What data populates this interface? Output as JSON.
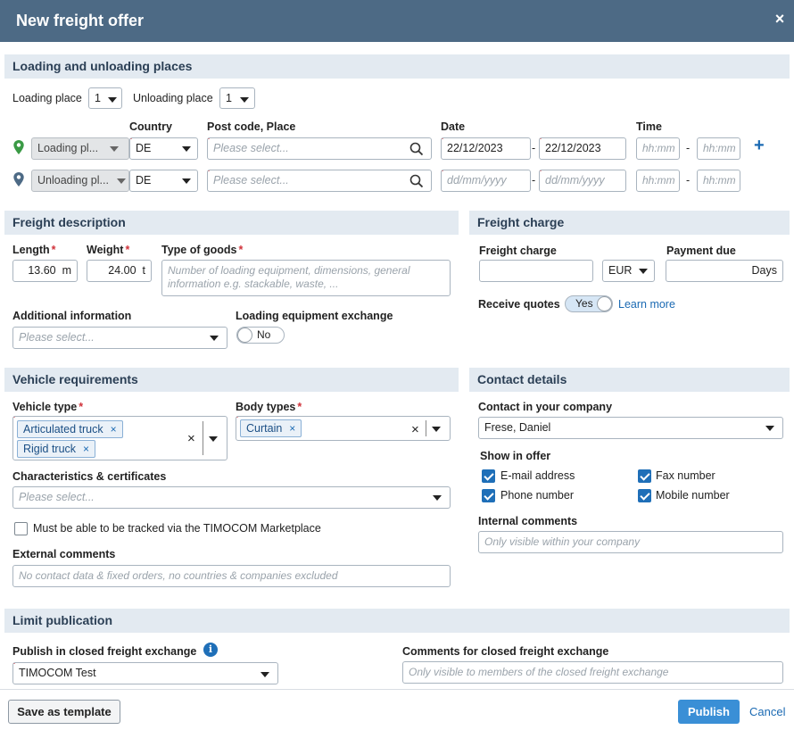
{
  "dialog": {
    "title": "New freight offer",
    "close_icon": "×"
  },
  "loading": {
    "section_title": "Loading and unloading places",
    "loading_place_label": "Loading place",
    "loading_place_value": "1",
    "unloading_place_label": "Unloading place",
    "unloading_place_value": "1",
    "col_country": "Country",
    "col_postcode": "Post code, Place",
    "col_date": "Date",
    "col_time": "Time",
    "rows": [
      {
        "type": "Loading pl...",
        "country": "DE",
        "place_placeholder": "Please select...",
        "date_from": "22/12/2023",
        "date_to": "22/12/2023",
        "time_from": "hh:mm",
        "time_to": "hh:mm",
        "pin_color": "#3a9a45"
      },
      {
        "type": "Unloading pl...",
        "country": "DE",
        "place_placeholder": "Please select...",
        "date_from": "dd/mm/yyyy",
        "date_to": "dd/mm/yyyy",
        "time_from": "hh:mm",
        "time_to": "hh:mm",
        "pin_color": "#4d6a85"
      }
    ],
    "dash": "-",
    "add_icon": "+"
  },
  "freight": {
    "section_title": "Freight description",
    "length_label": "Length",
    "length_value": "13.60",
    "length_unit": "m",
    "weight_label": "Weight",
    "weight_value": "24.00",
    "weight_unit": "t",
    "goods_label": "Type of goods",
    "goods_placeholder_1": "Number of loading equipment, dimensions, general",
    "goods_placeholder_2": "information e.g. stackable, waste, ...",
    "additional_label": "Additional information",
    "additional_placeholder": "Please select...",
    "exchange_label": "Loading equipment exchange",
    "exchange_value": "No",
    "required_mark": "*"
  },
  "charge": {
    "section_title": "Freight charge",
    "charge_label": "Freight charge",
    "currency": "EUR",
    "payment_label": "Payment due",
    "payment_unit": "Days",
    "quotes_label": "Receive quotes",
    "quotes_value": "Yes",
    "learn_more": "Learn more"
  },
  "vehicle": {
    "section_title": "Vehicle requirements",
    "type_label": "Vehicle type",
    "types": [
      "Articulated truck",
      "Rigid truck"
    ],
    "body_label": "Body types",
    "bodies": [
      "Curtain"
    ],
    "chip_remove": "×",
    "clear_icon": "×",
    "char_label": "Characteristics & certificates",
    "char_placeholder": "Please select...",
    "tracked_label": "Must be able to be tracked via the TIMOCOM Marketplace",
    "external_label": "External comments",
    "external_placeholder": "No contact data & fixed orders, no countries & companies excluded"
  },
  "contact": {
    "section_title": "Contact details",
    "company_label": "Contact in your company",
    "company_value": "Frese, Daniel",
    "show_label": "Show in offer",
    "opts": [
      "E-mail address",
      "Fax number",
      "Phone number",
      "Mobile number"
    ],
    "internal_label": "Internal comments",
    "internal_placeholder": "Only visible within your company"
  },
  "limit": {
    "section_title": "Limit publication",
    "closed_label": "Publish in closed freight exchange",
    "info_icon": "i",
    "closed_value": "TIMOCOM Test",
    "closed_comments_label": "Comments for closed freight exchange",
    "closed_comments_placeholder": "Only visible to members of the closed freight exchange"
  },
  "footer": {
    "save_template": "Save as template",
    "publish": "Publish",
    "cancel": "Cancel"
  },
  "colors": {
    "header": "#4d6a85",
    "section": "#e3eaf1",
    "primary": "#3a8fd6",
    "link": "#1b6ab3",
    "required": "#d0323a"
  }
}
